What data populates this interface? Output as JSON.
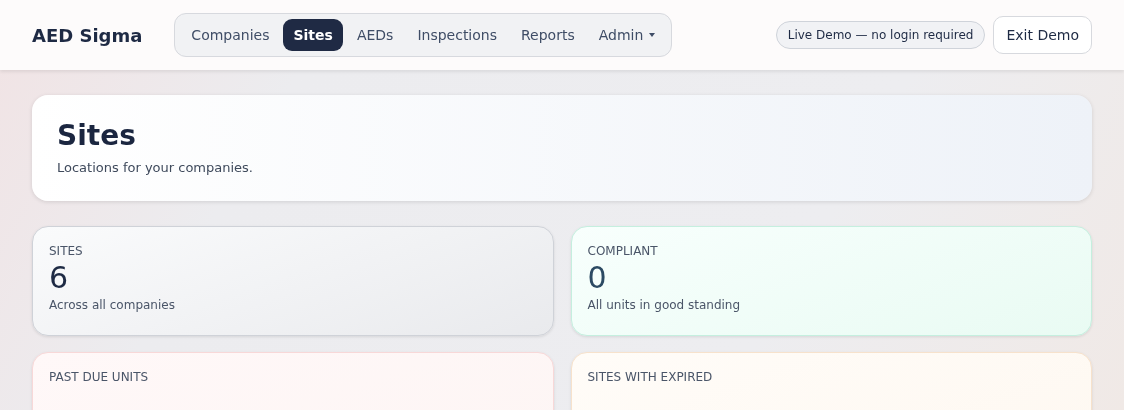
{
  "header": {
    "brand": "AED Sigma",
    "nav": [
      {
        "label": "Companies",
        "selected": false,
        "dropdown": false
      },
      {
        "label": "Sites",
        "selected": true,
        "dropdown": false
      },
      {
        "label": "AEDs",
        "selected": false,
        "dropdown": false
      },
      {
        "label": "Inspections",
        "selected": false,
        "dropdown": false
      },
      {
        "label": "Reports",
        "selected": false,
        "dropdown": false
      },
      {
        "label": "Admin",
        "selected": false,
        "dropdown": true
      }
    ],
    "demo_badge": "Live Demo — no login required",
    "exit_button": "Exit Demo"
  },
  "page": {
    "title": "Sites",
    "subtitle": "Locations for your companies."
  },
  "stats": [
    {
      "kind": "neutral",
      "label": "SITES",
      "value": "6",
      "note": "Across all companies"
    },
    {
      "kind": "success",
      "label": "COMPLIANT",
      "value": "0",
      "note": "All units in good standing"
    },
    {
      "kind": "danger",
      "label": "PAST DUE UNITS"
    },
    {
      "kind": "warning",
      "label": "SITES WITH EXPIRED"
    }
  ]
}
